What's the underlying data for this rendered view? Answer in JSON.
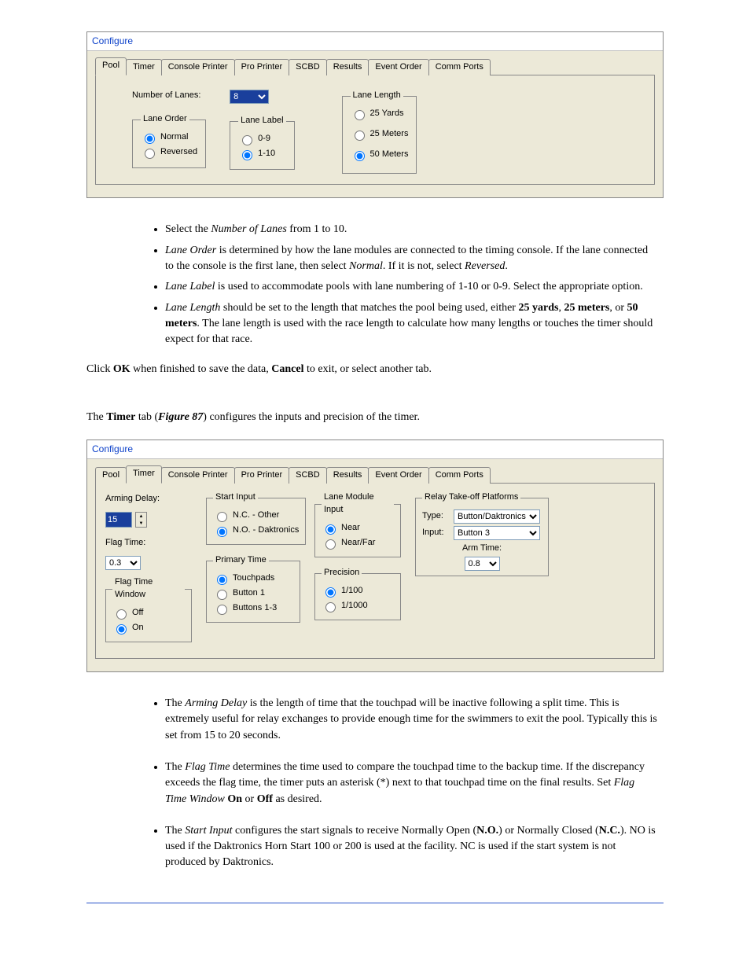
{
  "dialog1": {
    "title": "Configure",
    "tabs": [
      "Pool",
      "Timer",
      "Console Printer",
      "Pro Printer",
      "SCBD",
      "Results",
      "Event Order",
      "Comm Ports"
    ],
    "activeTabIndex": 0,
    "numberOfLanesLabel": "Number of Lanes:",
    "numberOfLanesValue": "8",
    "laneOrder": {
      "legend": "Lane Order",
      "options": [
        "Normal",
        "Reversed"
      ],
      "selected": 0
    },
    "laneLabel": {
      "legend": "Lane Label",
      "options": [
        "0-9",
        "1-10"
      ],
      "selected": 1
    },
    "laneLength": {
      "legend": "Lane Length",
      "options": [
        "25 Yards",
        "25 Meters",
        "50 Meters"
      ],
      "selected": 2
    }
  },
  "doc1": {
    "bullets": [
      {
        "parts": [
          {
            "t": "Select the "
          },
          {
            "t": "Number of Lanes",
            "i": true
          },
          {
            "t": " from 1 to 10."
          }
        ]
      },
      {
        "parts": [
          {
            "t": "Lane Order",
            "i": true
          },
          {
            "t": " is determined by how the lane modules are connected to the timing console. If the lane connected to the console is the first lane, then select "
          },
          {
            "t": "Normal",
            "i": true
          },
          {
            "t": ". If it is not, select "
          },
          {
            "t": "Reversed",
            "i": true
          },
          {
            "t": "."
          }
        ]
      },
      {
        "parts": [
          {
            "t": "Lane Label",
            "i": true
          },
          {
            "t": " is used to accommodate pools with lane numbering of 1-10 or 0-9. Select the appropriate option."
          }
        ]
      },
      {
        "parts": [
          {
            "t": "Lane Length",
            "i": true
          },
          {
            "t": " should be set to the length that matches the pool being used, either "
          },
          {
            "t": "25 yards",
            "b": true
          },
          {
            "t": ", "
          },
          {
            "t": "25 meters",
            "b": true
          },
          {
            "t": ", or "
          },
          {
            "t": "50 meters",
            "b": true
          },
          {
            "t": ". The lane length is used with the race length to calculate how many lengths or touches the timer should expect for that race."
          }
        ]
      }
    ],
    "paraParts": [
      {
        "t": "Click "
      },
      {
        "t": "OK",
        "b": true
      },
      {
        "t": " when finished to save the data, "
      },
      {
        "t": "Cancel",
        "b": true
      },
      {
        "t": " to exit, or select another tab."
      }
    ],
    "timerIntroParts": [
      {
        "t": "The "
      },
      {
        "t": "Timer",
        "b": true
      },
      {
        "t": " tab ("
      },
      {
        "t": "Figure 87",
        "i": true,
        "b": true
      },
      {
        "t": ") configures the inputs and precision of the timer."
      }
    ]
  },
  "dialog2": {
    "title": "Configure",
    "tabs": [
      "Pool",
      "Timer",
      "Console Printer",
      "Pro Printer",
      "SCBD",
      "Results",
      "Event Order",
      "Comm Ports"
    ],
    "activeTabIndex": 1,
    "armingDelay": {
      "label": "Arming Delay:",
      "value": "15"
    },
    "flagTime": {
      "label": "Flag Time:",
      "value": "0.3"
    },
    "flagTimeWindow": {
      "legend": "Flag Time Window",
      "options": [
        "Off",
        "On"
      ],
      "selected": 1
    },
    "startInput": {
      "legend": "Start Input",
      "options": [
        "N.C. - Other",
        "N.O. - Daktronics"
      ],
      "selected": 1
    },
    "primaryTime": {
      "legend": "Primary Time",
      "options": [
        "Touchpads",
        "Button 1",
        "Buttons 1-3"
      ],
      "selected": 0
    },
    "laneModuleInput": {
      "legend": "Lane Module Input",
      "options": [
        "Near",
        "Near/Far"
      ],
      "selected": 0
    },
    "precision": {
      "legend": "Precision",
      "options": [
        "1/100",
        "1/1000"
      ],
      "selected": 0
    },
    "relay": {
      "legend": "Relay Take-off Platforms",
      "typeLabel": "Type:",
      "typeValue": "Button/Daktronics",
      "inputLabel": "Input:",
      "inputValue": "Button 3",
      "armTimeLabel": "Arm Time:",
      "armTimeValue": "0.8"
    }
  },
  "doc2": {
    "bullets": [
      {
        "parts": [
          {
            "t": "The "
          },
          {
            "t": "Arming Delay",
            "i": true
          },
          {
            "t": " is the length of time that the touchpad will be inactive following a split time. This is extremely useful for relay exchanges to provide enough time for the swimmers to exit the pool. Typically this is set from 15 to 20 seconds."
          }
        ]
      },
      {
        "parts": [
          {
            "t": "The "
          },
          {
            "t": "Flag Time",
            "i": true
          },
          {
            "t": " determines the time used to compare the touchpad time to the backup time. If the discrepancy exceeds the flag time, the timer puts an asterisk (*) next to that touchpad time on the final results. Set "
          },
          {
            "t": "Flag Time Window",
            "i": true
          },
          {
            "t": " "
          },
          {
            "t": "On",
            "b": true
          },
          {
            "t": " or "
          },
          {
            "t": "Off",
            "b": true
          },
          {
            "t": " as desired."
          }
        ]
      },
      {
        "parts": [
          {
            "t": "The "
          },
          {
            "t": "Start Input",
            "i": true
          },
          {
            "t": " configures the start signals to receive Normally Open ("
          },
          {
            "t": "N.O.",
            "b": true
          },
          {
            "t": ") or Normally Closed ("
          },
          {
            "t": "N.C.",
            "b": true
          },
          {
            "t": "). NO is used if the Daktronics Horn Start 100 or 200 is used at the facility. NC is used if the start system is not produced by Daktronics."
          }
        ]
      }
    ]
  }
}
